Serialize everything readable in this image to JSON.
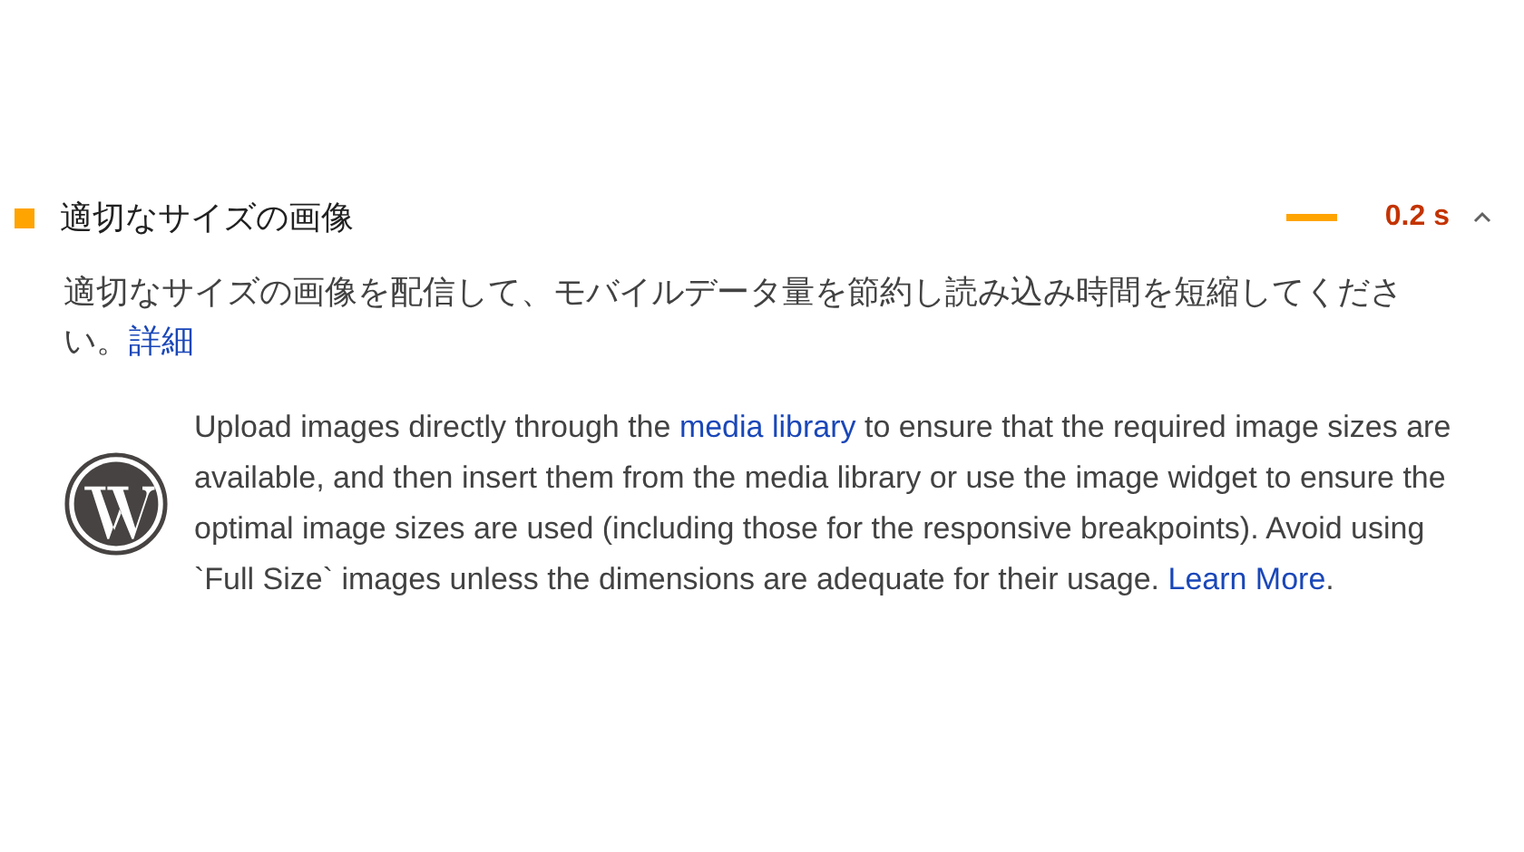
{
  "audit": {
    "title": "適切なサイズの画像",
    "color": "#ffa400",
    "value": "0.2 s",
    "expanded": true,
    "description": [
      {
        "kind": "text",
        "text": "適切なサイズの画像を配信して、モバイルデータ量を節約し読み込み時間を短縮してください。"
      },
      {
        "kind": "link",
        "text": "詳細"
      }
    ],
    "stack_pack": [
      {
        "kind": "text",
        "text": "Upload images directly through the "
      },
      {
        "kind": "link",
        "text": "media library"
      },
      {
        "kind": "text",
        "text": " to ensure that the required image sizes are available, and then insert them from the media library or use the image widget to ensure the optimal image sizes are used (including those for the responsive breakpoints). Avoid using `Full Size` images unless the dimensions are adequate for their usage. "
      },
      {
        "kind": "link",
        "text": "Learn More"
      },
      {
        "kind": "text",
        "text": "."
      }
    ]
  }
}
